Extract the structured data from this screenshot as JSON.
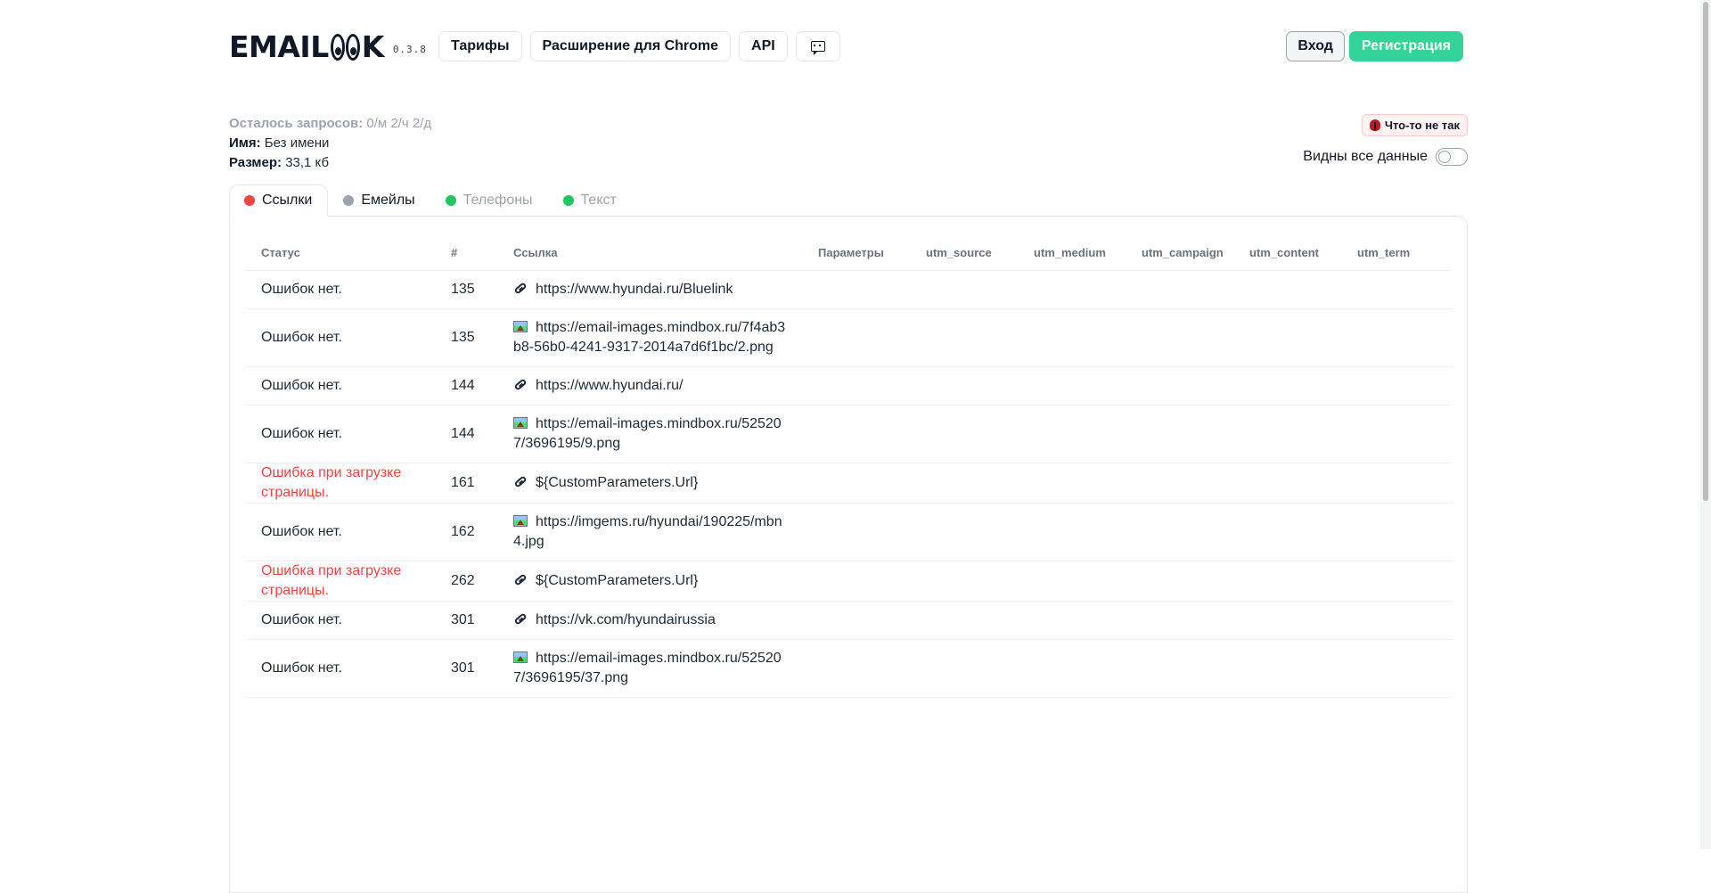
{
  "header": {
    "logo_left": "EMAIL",
    "logo_right": "K",
    "version": "0.3.8",
    "nav": [
      {
        "label": "Тарифы"
      },
      {
        "label": "Расширение для Chrome"
      },
      {
        "label": "API"
      }
    ],
    "feedback_icon": "chat-bubble-icon",
    "login_label": "Вход",
    "signup_label": "Регистрация"
  },
  "info": {
    "requests_label": "Осталось запросов:",
    "requests_value": "0/м 2/ч 2/д",
    "name_label": "Имя:",
    "name_value": "Без имени",
    "size_label": "Размер:",
    "size_value": "33,1 кб"
  },
  "report_button": {
    "label": "Что-то не так",
    "icon": "bug-icon"
  },
  "toggle": {
    "label": "Видны все данные",
    "on": false
  },
  "tabs": [
    {
      "label": "Ссылки",
      "dot_color": "#ef4444",
      "active": true
    },
    {
      "label": "Емейлы",
      "dot_color": "#9ca3af",
      "active": false
    },
    {
      "label": "Телефоны",
      "dot_color": "#22c55e",
      "active": false
    },
    {
      "label": "Текст",
      "dot_color": "#22c55e",
      "active": false
    }
  ],
  "table": {
    "columns": [
      "Статус",
      "#",
      "Ссылка",
      "Параметры",
      "utm_source",
      "utm_medium",
      "utm_campaign",
      "utm_content",
      "utm_term"
    ],
    "rows": [
      {
        "status": "Ошибок нет.",
        "error": false,
        "num": "135",
        "type": "link",
        "url": "https://www.hyundai.ru/Bluelink"
      },
      {
        "status": "Ошибок нет.",
        "error": false,
        "num": "135",
        "type": "image",
        "url": "https://email-images.mindbox.ru/7f4ab3b8-56b0-4241-9317-2014a7d6f1bc/2.png"
      },
      {
        "status": "Ошибок нет.",
        "error": false,
        "num": "144",
        "type": "link",
        "url": "https://www.hyundai.ru/"
      },
      {
        "status": "Ошибок нет.",
        "error": false,
        "num": "144",
        "type": "image",
        "url": "https://email-images.mindbox.ru/525207/3696195/9.png"
      },
      {
        "status": "Ошибка при загрузке страницы.",
        "error": true,
        "num": "161",
        "type": "link",
        "url": "${CustomParameters.Url}"
      },
      {
        "status": "Ошибок нет.",
        "error": false,
        "num": "162",
        "type": "image",
        "url": "https://imgems.ru/hyundai/190225/mbn4.jpg"
      },
      {
        "status": "Ошибка при загрузке страницы.",
        "error": true,
        "num": "262",
        "type": "link",
        "url": "${CustomParameters.Url}"
      },
      {
        "status": "Ошибок нет.",
        "error": false,
        "num": "301",
        "type": "link",
        "url": "https://vk.com/hyundairussia"
      },
      {
        "status": "Ошибок нет.",
        "error": false,
        "num": "301",
        "type": "image",
        "url": "https://email-images.mindbox.ru/525207/3696195/37.png"
      }
    ]
  }
}
